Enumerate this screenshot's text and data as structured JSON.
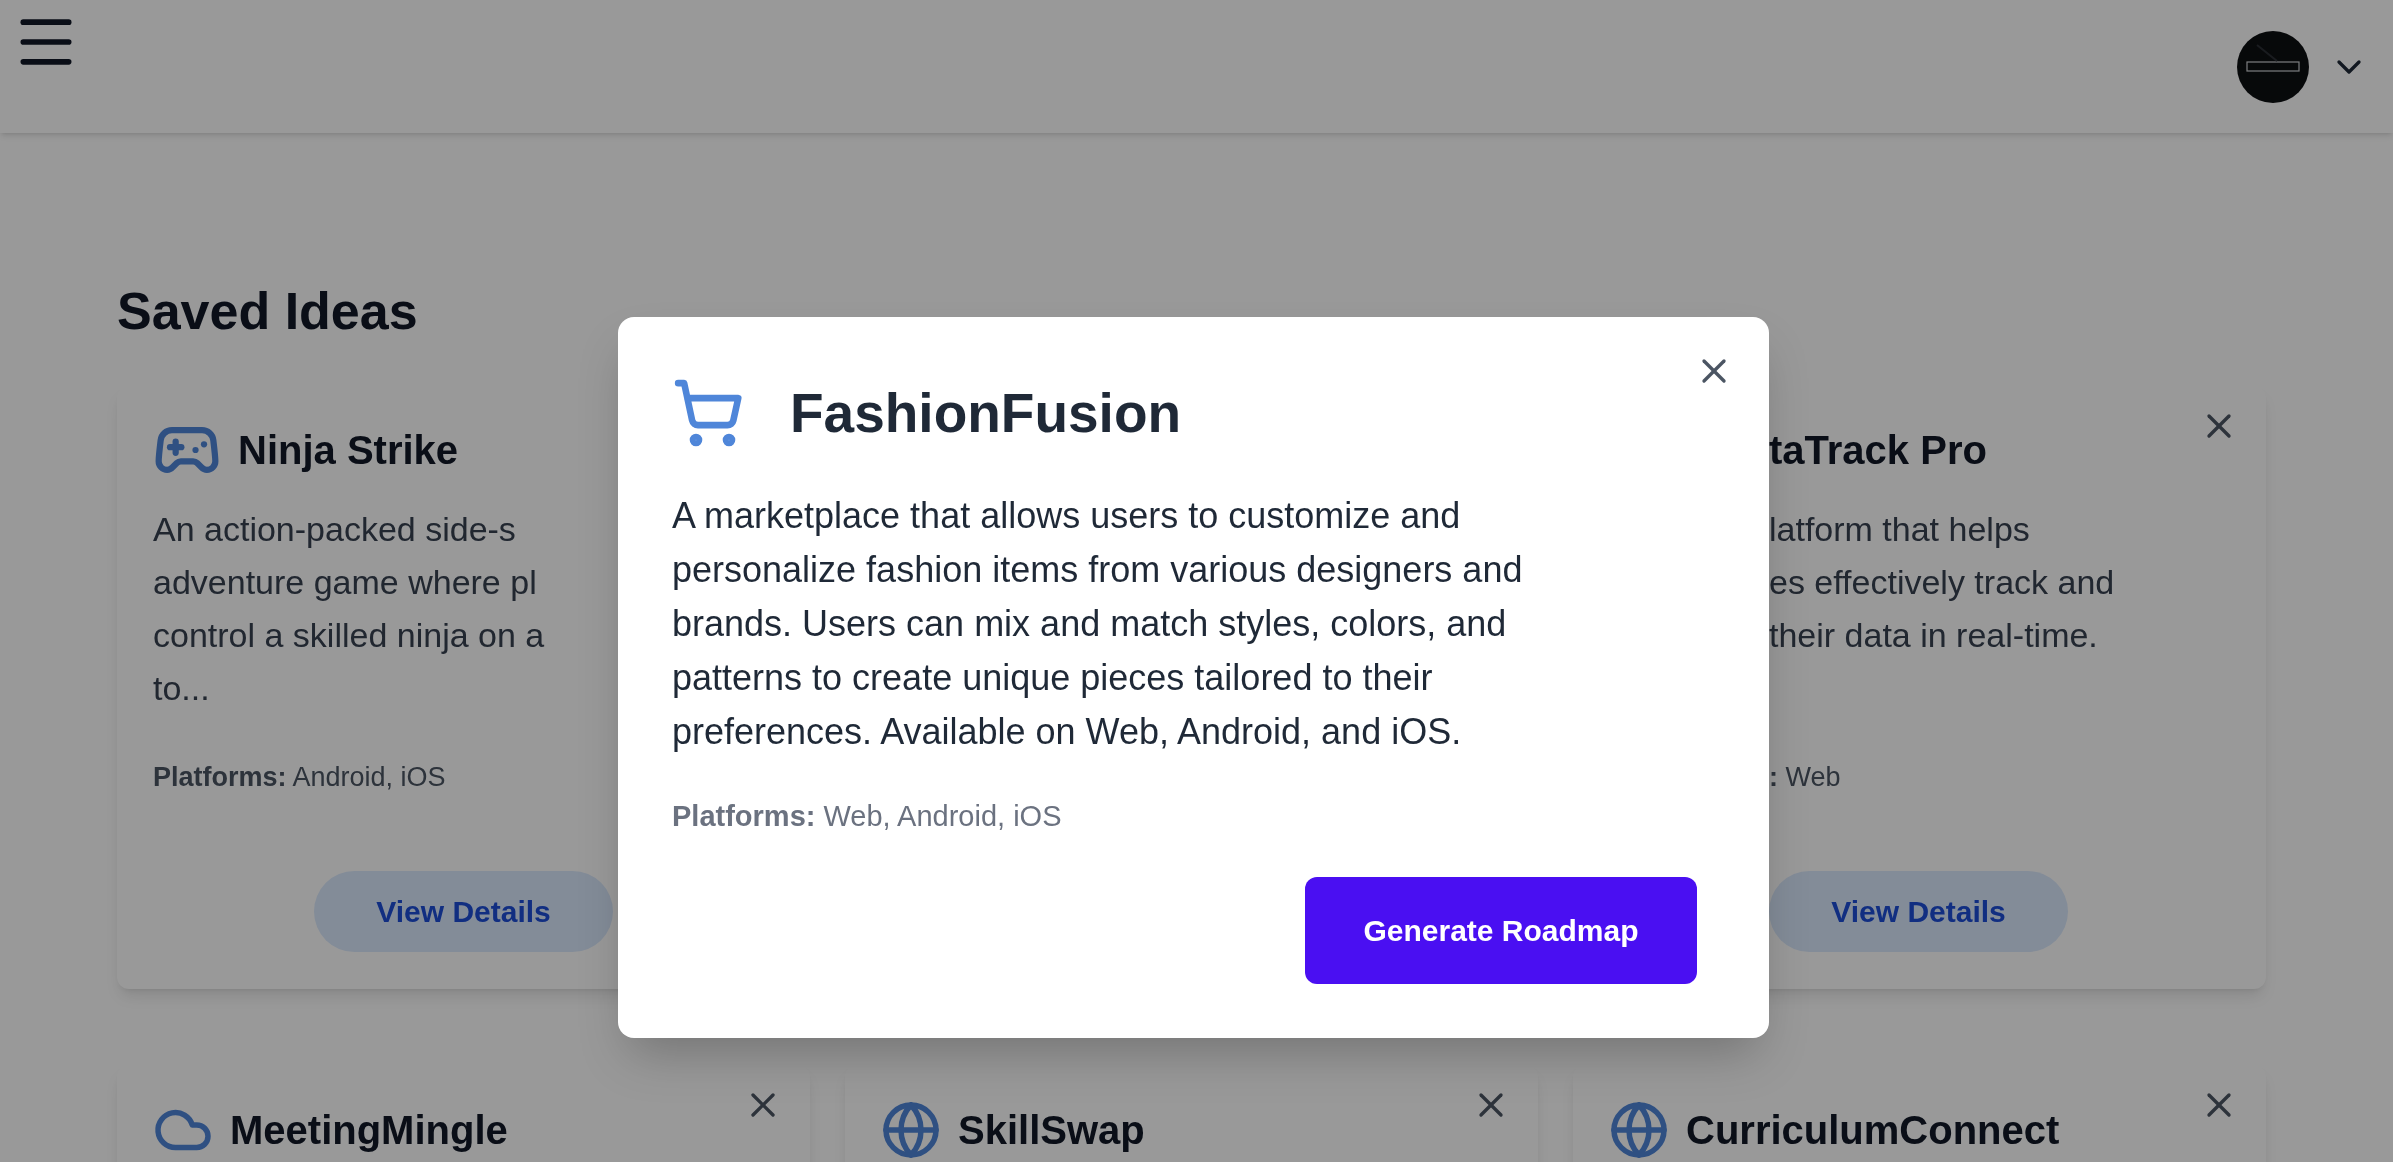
{
  "heading": "Saved Ideas",
  "left_card": {
    "kind": "gamepad",
    "title": "Ninja Strike",
    "description_lines": [
      "An action-packed side-s",
      "adventure game where pl",
      "control a skilled ninja on a",
      "to..."
    ],
    "platforms_label": "Platforms:",
    "platforms": "Android, iOS",
    "button": "View Details"
  },
  "right_card": {
    "title": "taTrack Pro",
    "description_lines": [
      "latform that helps",
      "es effectively track and",
      "their data in real-time."
    ],
    "platforms_label": ":",
    "platforms": "Web",
    "button": "View Details"
  },
  "bottom_cards": [
    {
      "kind": "cloud",
      "title": "MeetingMingle"
    },
    {
      "kind": "globe",
      "title": "SkillSwap"
    },
    {
      "kind": "globe",
      "title": "CurriculumConnect"
    }
  ],
  "modal": {
    "kind": "cart",
    "title": "FashionFusion",
    "description": "A marketplace that allows users to customize and personalize fashion items from various designers and brands. Users can mix and match styles, colors, and patterns to create unique pieces tailored to their preferences. Available on Web, Android, and iOS.",
    "platforms_label": "Platforms:",
    "platforms": "Web, Android, iOS",
    "button": "Generate Roadmap"
  }
}
